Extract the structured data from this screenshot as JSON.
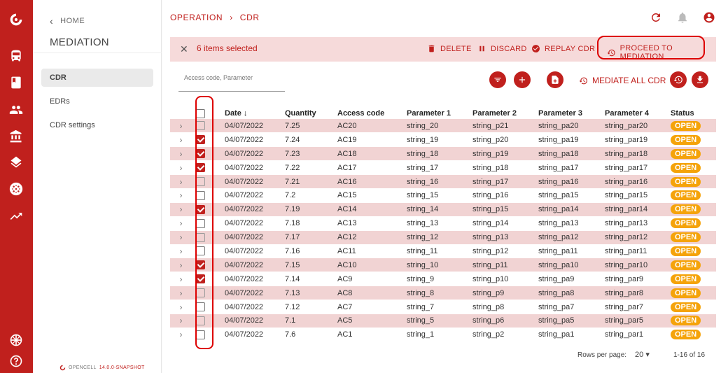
{
  "rail": {
    "icons": [
      "opencell-logo-icon",
      "bus-icon",
      "book-icon",
      "users-icon",
      "bank-icon",
      "layers-icon",
      "mediation-icon",
      "trend-icon",
      "globe-icon",
      "help-icon"
    ]
  },
  "sidebar": {
    "home_label": "HOME",
    "title": "MEDIATION",
    "items": [
      {
        "label": "CDR",
        "active": true
      },
      {
        "label": "EDRs",
        "active": false
      },
      {
        "label": "CDR settings",
        "active": false
      }
    ],
    "footer_brand": "OPENCELL",
    "footer_version": "14.0.0-SNAPSHOT"
  },
  "header": {
    "crumb1": "OPERATION",
    "crumb_sep": "›",
    "crumb2": "CDR"
  },
  "selection": {
    "close": "✕",
    "count": "6 items selected",
    "delete": "DELETE",
    "discard": "DISCARD",
    "replay": "REPLAY CDR",
    "proceed": "PROCEED TO MEDIATION"
  },
  "toolbar": {
    "search_placeholder": "Access code, Parameter",
    "mediate_all": "MEDIATE ALL CDR"
  },
  "table": {
    "columns": [
      "Date",
      "Quantity",
      "Access code",
      "Parameter 1",
      "Parameter 2",
      "Parameter 3",
      "Parameter 4",
      "Status"
    ],
    "date_sort_arrow": "↓",
    "rows": [
      {
        "date": "04/07/2022",
        "qty": "7.25",
        "code": "AC20",
        "p1": "string_20",
        "p2": "string_p21",
        "p3": "string_pa20",
        "p4": "string_par20",
        "status": "OPEN",
        "checked": false,
        "hl": true
      },
      {
        "date": "04/07/2022",
        "qty": "7.24",
        "code": "AC19",
        "p1": "string_19",
        "p2": "string_p20",
        "p3": "string_pa19",
        "p4": "string_par19",
        "status": "OPEN",
        "checked": true,
        "hl": false
      },
      {
        "date": "04/07/2022",
        "qty": "7.23",
        "code": "AC18",
        "p1": "string_18",
        "p2": "string_p19",
        "p3": "string_pa18",
        "p4": "string_par18",
        "status": "OPEN",
        "checked": true,
        "hl": true
      },
      {
        "date": "04/07/2022",
        "qty": "7.22",
        "code": "AC17",
        "p1": "string_17",
        "p2": "string_p18",
        "p3": "string_pa17",
        "p4": "string_par17",
        "status": "OPEN",
        "checked": true,
        "hl": false
      },
      {
        "date": "04/07/2022",
        "qty": "7.21",
        "code": "AC16",
        "p1": "string_16",
        "p2": "string_p17",
        "p3": "string_pa16",
        "p4": "string_par16",
        "status": "OPEN",
        "checked": false,
        "hl": true
      },
      {
        "date": "04/07/2022",
        "qty": "7.2",
        "code": "AC15",
        "p1": "string_15",
        "p2": "string_p16",
        "p3": "string_pa15",
        "p4": "string_par15",
        "status": "OPEN",
        "checked": false,
        "hl": false
      },
      {
        "date": "04/07/2022",
        "qty": "7.19",
        "code": "AC14",
        "p1": "string_14",
        "p2": "string_p15",
        "p3": "string_pa14",
        "p4": "string_par14",
        "status": "OPEN",
        "checked": true,
        "hl": true
      },
      {
        "date": "04/07/2022",
        "qty": "7.18",
        "code": "AC13",
        "p1": "string_13",
        "p2": "string_p14",
        "p3": "string_pa13",
        "p4": "string_par13",
        "status": "OPEN",
        "checked": false,
        "hl": false
      },
      {
        "date": "04/07/2022",
        "qty": "7.17",
        "code": "AC12",
        "p1": "string_12",
        "p2": "string_p13",
        "p3": "string_pa12",
        "p4": "string_par12",
        "status": "OPEN",
        "checked": false,
        "hl": true
      },
      {
        "date": "04/07/2022",
        "qty": "7.16",
        "code": "AC11",
        "p1": "string_11",
        "p2": "string_p12",
        "p3": "string_pa11",
        "p4": "string_par11",
        "status": "OPEN",
        "checked": false,
        "hl": false
      },
      {
        "date": "04/07/2022",
        "qty": "7.15",
        "code": "AC10",
        "p1": "string_10",
        "p2": "string_p11",
        "p3": "string_pa10",
        "p4": "string_par10",
        "status": "OPEN",
        "checked": true,
        "hl": true
      },
      {
        "date": "04/07/2022",
        "qty": "7.14",
        "code": "AC9",
        "p1": "string_9",
        "p2": "string_p10",
        "p3": "string_pa9",
        "p4": "string_par9",
        "status": "OPEN",
        "checked": true,
        "hl": false
      },
      {
        "date": "04/07/2022",
        "qty": "7.13",
        "code": "AC8",
        "p1": "string_8",
        "p2": "string_p9",
        "p3": "string_pa8",
        "p4": "string_par8",
        "status": "OPEN",
        "checked": false,
        "hl": true
      },
      {
        "date": "04/07/2022",
        "qty": "7.12",
        "code": "AC7",
        "p1": "string_7",
        "p2": "string_p8",
        "p3": "string_pa7",
        "p4": "string_par7",
        "status": "OPEN",
        "checked": false,
        "hl": false
      },
      {
        "date": "04/07/2022",
        "qty": "7.1",
        "code": "AC5",
        "p1": "string_5",
        "p2": "string_p6",
        "p3": "string_pa5",
        "p4": "string_par5",
        "status": "OPEN",
        "checked": false,
        "hl": true
      },
      {
        "date": "04/07/2022",
        "qty": "7.6",
        "code": "AC1",
        "p1": "string_1",
        "p2": "string_p2",
        "p3": "string_pa1",
        "p4": "string_par1",
        "status": "OPEN",
        "checked": false,
        "hl": false
      }
    ]
  },
  "pagination": {
    "rows_label": "Rows per page:",
    "rows_value": "20",
    "range": "1-16 of 16"
  },
  "colors": {
    "brand": "#c0201d",
    "row_highlight": "#f1d3d3",
    "badge": "#f5a30a",
    "annotation": "#dd0000"
  }
}
